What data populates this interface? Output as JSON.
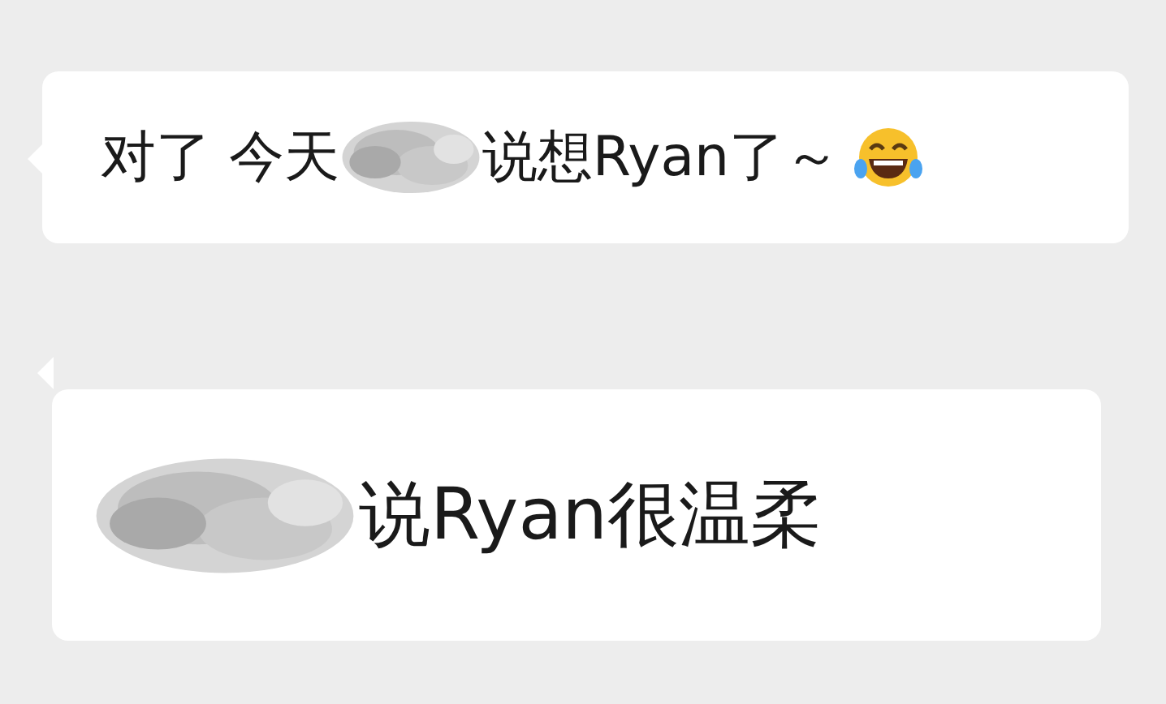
{
  "messages": [
    {
      "parts": [
        {
          "kind": "text",
          "text": "对了 今天"
        },
        {
          "kind": "redacted"
        },
        {
          "kind": "text",
          "text": "说想Ryan了～"
        },
        {
          "kind": "emoji"
        }
      ]
    },
    {
      "parts": [
        {
          "kind": "redacted"
        },
        {
          "kind": "text",
          "text": "说Ryan很温柔"
        }
      ]
    }
  ]
}
